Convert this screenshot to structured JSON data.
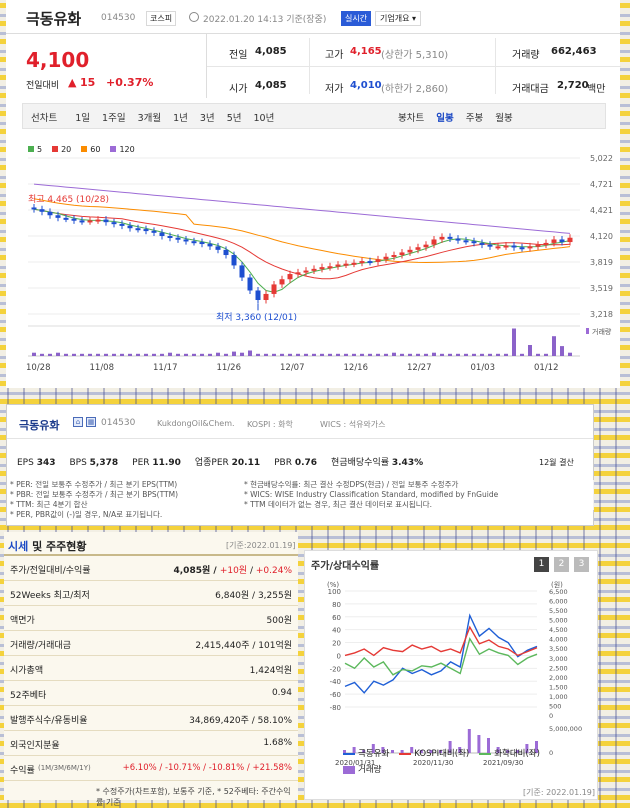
{
  "header": {
    "name": "극동유화",
    "code": "014530",
    "market": "코스피",
    "datetime": "2022.01.20 14:13 기준(장중)",
    "realtime_badge": "실시간",
    "overview_btn": "기업개요 ▾"
  },
  "price": {
    "current": "4,100",
    "change_label": "전일대비",
    "change_arrow": "▲",
    "change": "15",
    "change_pct": "+0.37%"
  },
  "stats": {
    "prev_label": "전일",
    "prev": "4,085",
    "high_label": "고가",
    "high": "4,165",
    "high_limit": "(상한가 5,310)",
    "volume_label": "거래량",
    "volume": "662,463",
    "open_label": "시가",
    "open": "4,085",
    "low_label": "저가",
    "low": "4,010",
    "low_limit": "(하한가 2,860)",
    "amount_label": "거래대금",
    "amount": "2,720",
    "amount_unit": "백만"
  },
  "chart_tabs": {
    "left": [
      "선차트",
      "1일",
      "1주일",
      "3개월",
      "1년",
      "3년",
      "5년",
      "10년"
    ],
    "right": [
      "봉차트",
      "일봉",
      "주봉",
      "월봉"
    ],
    "active_right": "일봉"
  },
  "legend": [
    {
      "label": "5",
      "color": "#4caf50"
    },
    {
      "label": "20",
      "color": "#e53935"
    },
    {
      "label": "60",
      "color": "#fb8c00"
    },
    {
      "label": "120",
      "color": "#9c6bd6"
    }
  ],
  "chart_data": {
    "type": "candlestick",
    "y_ticks": [
      "5,022",
      "4,721",
      "4,421",
      "4,120",
      "3,819",
      "3,519",
      "3,218"
    ],
    "ylim": [
      3218,
      5022
    ],
    "x_labels": [
      "10/28",
      "11/08",
      "11/17",
      "11/26",
      "12/07",
      "12/16",
      "12/27",
      "01/03",
      "01/12"
    ],
    "high_annotation": "최고 4,465 (10/28)",
    "low_annotation": "최저 3,360 (12/01)",
    "volume_label": "거래량",
    "candles": [
      4430,
      4400,
      4360,
      4330,
      4320,
      4300,
      4290,
      4300,
      4310,
      4280,
      4260,
      4240,
      4210,
      4200,
      4180,
      4160,
      4120,
      4100,
      4080,
      4060,
      4050,
      4030,
      4000,
      3960,
      3900,
      3780,
      3640,
      3490,
      3380,
      3450,
      3560,
      3620,
      3680,
      3700,
      3720,
      3740,
      3760,
      3770,
      3790,
      3800,
      3810,
      3830,
      3820,
      3850,
      3880,
      3900,
      3930,
      3960,
      3990,
      4020,
      4080,
      4110,
      4090,
      4070,
      4060,
      4040,
      4020,
      4000,
      4000,
      4010,
      3990,
      3980,
      4000,
      4020,
      4040,
      4080,
      4050,
      4100
    ],
    "volume": [
      3,
      2,
      2,
      3,
      2,
      2,
      2,
      2,
      2,
      2,
      2,
      2,
      2,
      2,
      2,
      2,
      2,
      3,
      2,
      2,
      2,
      2,
      2,
      3,
      2,
      4,
      3,
      5,
      2,
      2,
      2,
      2,
      2,
      2,
      2,
      2,
      2,
      2,
      2,
      2,
      2,
      2,
      2,
      2,
      2,
      3,
      2,
      2,
      2,
      2,
      3,
      2,
      2,
      2,
      2,
      2,
      2,
      2,
      2,
      2,
      25,
      2,
      10,
      2,
      2,
      18,
      9,
      3
    ]
  },
  "company": {
    "name": "극동유화",
    "code": "014530",
    "eng": "KukdongOil&Chem.",
    "market": "KOSPI : 화학",
    "wics": "WICS : 석유와가스"
  },
  "metrics": [
    {
      "k": "EPS",
      "v": "343"
    },
    {
      "k": "BPS",
      "v": "5,378"
    },
    {
      "k": "PER",
      "v": "11.90"
    },
    {
      "k": "업종PER",
      "v": "20.11"
    },
    {
      "k": "PBR",
      "v": "0.76"
    },
    {
      "k": "현금배당수익률",
      "v": "3.43%"
    }
  ],
  "settle": "12월 결산",
  "notes_left": [
    "* PER: 전일 보통주 수정주가 / 최근 분기 EPS(TTM)",
    "* PBR: 전일 보통주 수정주가 / 최근 분기 BPS(TTM)",
    "* TTM: 최근 4분기 합산",
    "* PER, PBR값이 (-)일 경우, N/A로 표기됩니다."
  ],
  "notes_right": [
    "* 현금배당수익률: 최근 결산 수정DPS(현금) / 전일 보통주 수정주가",
    "* WICS: WISE Industry Classification Standard, modified by FnGuide",
    "* TTM 데이터가 없는 경우, 최근 결산 데이터로 표시됩니다."
  ],
  "table": {
    "title_a": "시세",
    "title_b": " 및 주주현황",
    "date": "[기준:2022.01.19]",
    "rows": [
      {
        "k": "주가/전일대비/수익률",
        "v1": "4,085원 / ",
        "v2": "+10원",
        "v3": " / ",
        "v4": "+0.24%"
      },
      {
        "k": "52Weeks 최고/최저",
        "v1": "6,840원 / 3,255원"
      },
      {
        "k": "액면가",
        "v1": "500원"
      },
      {
        "k": "거래량/거래대금",
        "v1": "2,415,440주 / 101억원"
      },
      {
        "k": "시가총액",
        "v1": "1,424억원"
      },
      {
        "k": "52주베타",
        "v1": "0.94"
      },
      {
        "k": "발행주식수/유동비율",
        "v1": "34,869,420주 / 58.10%"
      },
      {
        "k": "외국인지분율",
        "v1": "1.68%"
      },
      {
        "k": "수익률",
        "k2": "(1M/3M/6M/1Y)",
        "v1": "+6.10% / -10.71% / -10.81% / +21.58%"
      }
    ],
    "footnote": "* 수정주가(차트포함), 보통주 기준, * 52주베타: 주간수익률 기준"
  },
  "rel": {
    "title": "주가/상대수익률",
    "tabs": [
      "1",
      "2",
      "3"
    ],
    "left_unit": "(%)",
    "right_unit": "(원)",
    "left_ticks": [
      "100",
      "80",
      "60",
      "40",
      "20",
      "0",
      "-20",
      "-40",
      "-60",
      "-80"
    ],
    "right_ticks": [
      "6,500",
      "6,000",
      "5,500",
      "5,000",
      "4,500",
      "4,000",
      "3,500",
      "3,000",
      "2,500",
      "2,000",
      "1,500",
      "1,000",
      "500",
      "0"
    ],
    "vol_ticks": [
      "5,000,000",
      "0"
    ],
    "x": [
      "2020/01/31",
      "2020/11/30",
      "2021/09/30"
    ],
    "legend": [
      "극동유화",
      "KOSPI대비(좌)",
      "화학대비(좌)",
      "거래량"
    ],
    "date": "[기준: 2022.01.19]"
  }
}
